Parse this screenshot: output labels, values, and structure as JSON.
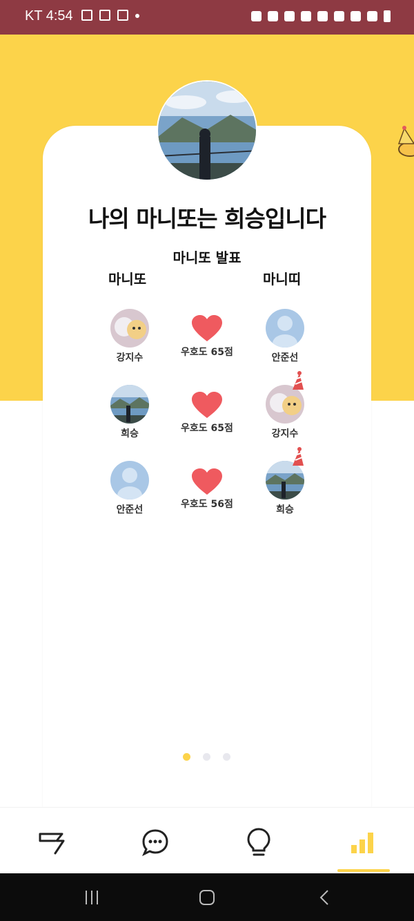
{
  "status_bar": {
    "time": "KT 4:54"
  },
  "profile": {
    "alt": "profile-photo"
  },
  "headline": "나의 마니또는 희승입니다",
  "section": {
    "title": "마니또 발표",
    "left_label": "마니또",
    "right_label": "마니띠"
  },
  "pairs": [
    {
      "manito": "강지수",
      "score": "우호도 65점",
      "maniti": "안준선"
    },
    {
      "manito": "희승",
      "score": "우호도 65점",
      "maniti": "강지수"
    },
    {
      "manito": "안준선",
      "score": "우호도 56점",
      "maniti": "희승"
    }
  ],
  "pager": {
    "pages": 3,
    "active": 0
  },
  "bottom_nav": {
    "items": [
      "flag-icon",
      "chat-icon",
      "lightbulb-icon",
      "chart-icon"
    ],
    "active": "chart-icon"
  },
  "colors": {
    "accent": "#fcd34a",
    "status_bar": "#8e3a43",
    "heart": "#ef5a5f",
    "gray_avatar": "#a9c7e6"
  }
}
